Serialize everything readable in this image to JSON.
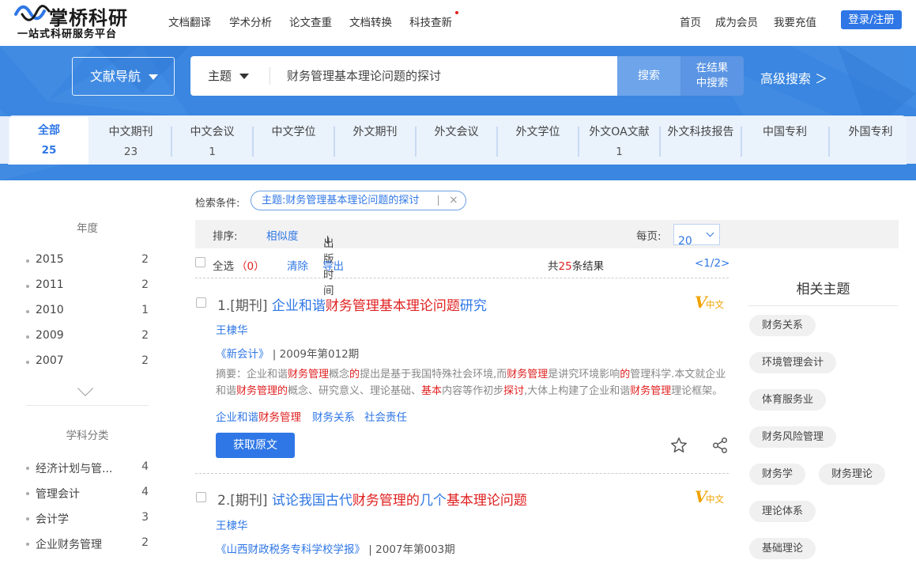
{
  "header": {
    "logo_title": "掌桥科研",
    "logo_subtitle": "一站式科研服务平台",
    "nav": [
      "文档翻译",
      "学术分析",
      "论文查重",
      "文档转换",
      "科技查新"
    ],
    "right_nav": [
      "首页",
      "成为会员",
      "我要充值"
    ],
    "login": "登录/注册"
  },
  "search": {
    "nav_dropdown": "文献导航",
    "field_select": "主题",
    "query": "财务管理基本理论问题的探讨",
    "search_button": "搜索",
    "search_in_results_1": "在结果",
    "search_in_results_2": "中搜索",
    "advanced": "高级搜索 ＞"
  },
  "tabs": [
    {
      "label": "全部",
      "count": "25"
    },
    {
      "label": "中文期刊",
      "count": "23"
    },
    {
      "label": "中文会议",
      "count": "1"
    },
    {
      "label": "中文学位",
      "count": ""
    },
    {
      "label": "外文期刊",
      "count": ""
    },
    {
      "label": "外文会议",
      "count": ""
    },
    {
      "label": "外文学位",
      "count": ""
    },
    {
      "label": "外文OA文献",
      "count": "1"
    },
    {
      "label": "外文科技报告",
      "count": ""
    },
    {
      "label": "中国专利",
      "count": ""
    },
    {
      "label": "外国专利",
      "count": ""
    }
  ],
  "sidebar": {
    "year_title": "年度",
    "years": [
      {
        "label": "2015",
        "count": "2"
      },
      {
        "label": "2011",
        "count": "2"
      },
      {
        "label": "2010",
        "count": "1"
      },
      {
        "label": "2009",
        "count": "2"
      },
      {
        "label": "2007",
        "count": "2"
      }
    ],
    "subject_title": "学科分类",
    "subjects": [
      {
        "label": "经济计划与管...",
        "count": "4"
      },
      {
        "label": "管理会计",
        "count": "4"
      },
      {
        "label": "会计学",
        "count": "3"
      },
      {
        "label": "企业财务管理",
        "count": "2"
      }
    ]
  },
  "conditions": {
    "label": "检索条件:",
    "tag": "主题:财务管理基本理论问题的探讨",
    "remove": "×"
  },
  "sort": {
    "label": "排序:",
    "relevance": "相似度",
    "date": "出版时间",
    "arrow": "↓",
    "per_page_label": "每页:",
    "per_page": "20"
  },
  "toolbar": {
    "select_all": "全选",
    "selected_count": "（0）",
    "clear": "清除",
    "export": "导出",
    "total_prefix": "共",
    "total": "25",
    "total_suffix": "条结果",
    "pager": "<1/2>"
  },
  "results": [
    {
      "index": "1.",
      "type": "[期刊]",
      "title_parts": [
        {
          "t": "企业和谐",
          "hl": false
        },
        {
          "t": "财务管理基本理论问题",
          "hl": true
        },
        {
          "t": "研究",
          "hl": false
        }
      ],
      "lang_badge": "中文",
      "author": "王棣华",
      "journal": "《新会计》",
      "issue": "| 2009年第012期",
      "abstract_parts": [
        {
          "t": "摘要：企业和谐",
          "hl": false
        },
        {
          "t": "财务管理",
          "hl": true
        },
        {
          "t": "概念",
          "hl": false
        },
        {
          "t": "的",
          "hl": true
        },
        {
          "t": "提出是基于我国特殊社会环境,而",
          "hl": false
        },
        {
          "t": "财务管理",
          "hl": true
        },
        {
          "t": "是讲究环境影响",
          "hl": false
        },
        {
          "t": "的",
          "hl": true
        },
        {
          "t": "管理科学.本文就企业和谐",
          "hl": false
        },
        {
          "t": "财务管理的",
          "hl": true
        },
        {
          "t": "概念、研究意义、理论基础、",
          "hl": false
        },
        {
          "t": "基本",
          "hl": true
        },
        {
          "t": "内容等作初步",
          "hl": false
        },
        {
          "t": "探讨",
          "hl": true
        },
        {
          "t": ",大体上构建了企业和谐",
          "hl": false
        },
        {
          "t": "财务管理",
          "hl": true
        },
        {
          "t": "理论框架。",
          "hl": false
        }
      ],
      "keywords": [
        [
          {
            "t": "企业和谐",
            "hl": false
          },
          {
            "t": "财务管理",
            "hl": true
          }
        ],
        [
          {
            "t": "财务关系",
            "hl": false
          }
        ],
        [
          {
            "t": "社会责任",
            "hl": false
          }
        ]
      ],
      "get_button": "获取原文"
    },
    {
      "index": "2.",
      "type": "[期刊]",
      "title_parts": [
        {
          "t": "试论我国古代",
          "hl": false
        },
        {
          "t": "财务管理的",
          "hl": true
        },
        {
          "t": "几个",
          "hl": false
        },
        {
          "t": "基本理论问题",
          "hl": true
        }
      ],
      "lang_badge": "中文",
      "author": "王棣华",
      "journal": "《山西财政税务专科学校学报》",
      "issue": "| 2007年第003期"
    }
  ],
  "related": {
    "title": "相关主题",
    "chips": [
      "财务关系",
      "环境管理会计",
      "体育服务业",
      "财务风险管理",
      "财务学",
      "财务理论",
      "理论体系",
      "基础理论"
    ]
  },
  "colors": {
    "brand": "#2f77e6",
    "banner": "#3a86e0",
    "highlight": "#e02020",
    "badge": "#f0a200"
  }
}
